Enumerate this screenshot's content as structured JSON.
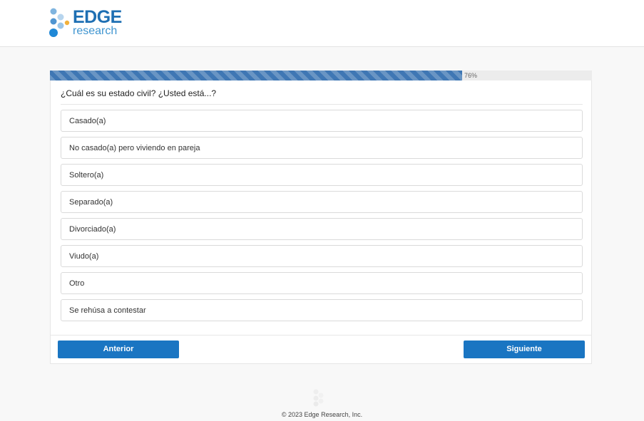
{
  "brand": {
    "name_line1": "EDGE",
    "name_line2": "research"
  },
  "progress": {
    "percent": 76,
    "label": "76%"
  },
  "question": {
    "text": "¿Cuál es su estado civil? ¿Usted está...?"
  },
  "options": [
    {
      "label": "Casado(a)"
    },
    {
      "label": "No casado(a) pero viviendo en pareja"
    },
    {
      "label": "Soltero(a)"
    },
    {
      "label": "Separado(a)"
    },
    {
      "label": "Divorciado(a)"
    },
    {
      "label": "Viudo(a)"
    },
    {
      "label": "Otro"
    },
    {
      "label": "Se rehúsa a contestar"
    }
  ],
  "navigation": {
    "previous_label": "Anterior",
    "next_label": "Siguiente"
  },
  "footer": {
    "copyright": "© 2023 Edge Research, Inc."
  },
  "colors": {
    "brand_blue": "#1e6fb3",
    "button_blue": "#1a75c2",
    "progress_blue": "#3f77b4"
  }
}
